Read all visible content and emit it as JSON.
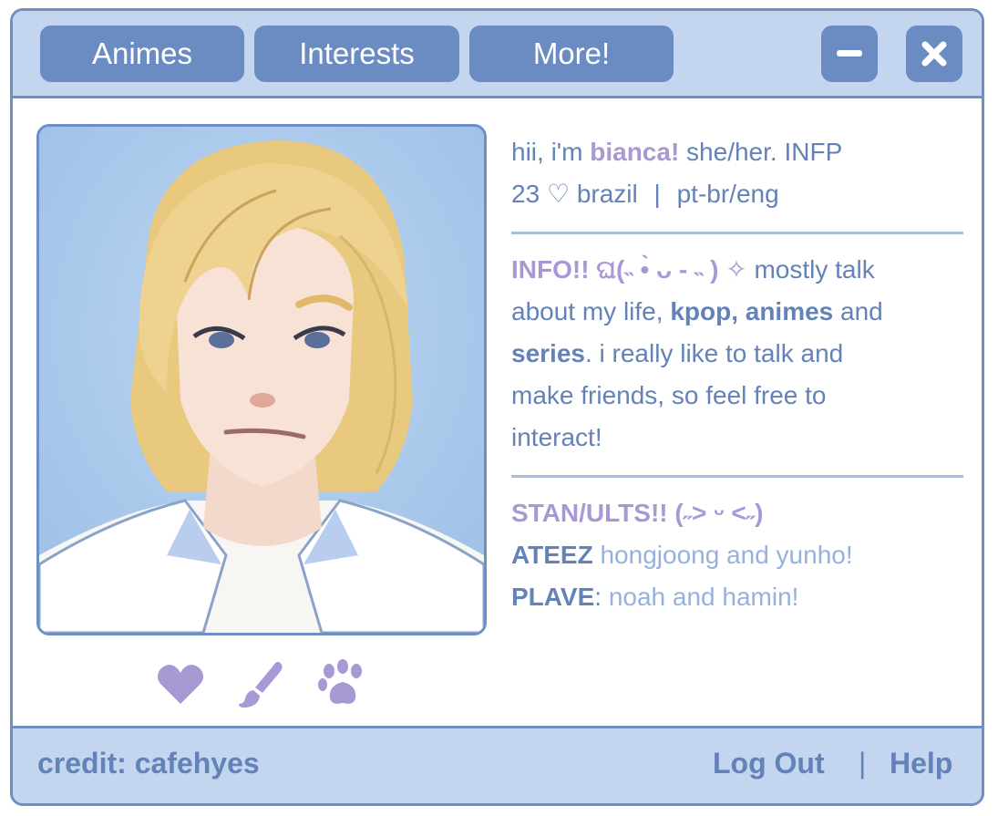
{
  "tabs": {
    "animes": "Animes",
    "interests": "Interests",
    "more": "More!"
  },
  "profile": {
    "intro_prefix": "hii, i'm ",
    "name": "bianca!",
    "intro_suffix": " she/her. INFP",
    "age": "23",
    "heart_glyph": "♡",
    "country": " brazil",
    "separator": "|",
    "languages": "pt-br/eng",
    "info_label": "INFO!! ଘ(˵ •̀ ᴗ - ˵ ) ✧",
    "info_text_1": " mostly talk",
    "info_text_2": "about my life, ",
    "info_bold_1": "kpop, animes",
    "info_text_3": " and",
    "info_bold_2": "series",
    "info_text_4": ". i really like to talk and",
    "info_text_5": "make friends, so feel free to",
    "info_text_6": "interact!",
    "stan_label": "STAN/ULTS!! (˶˃ ᵕ ˂˶)",
    "group1": "ATEEZ",
    "group1_members": " hongjoong and yunho!",
    "group2": "PLAVE",
    "group2_colon": ":",
    "group2_members": " noah and hamin!"
  },
  "icons": [
    "heart-icon",
    "paintbrush-icon",
    "paw-icon"
  ],
  "footer": {
    "credit": "credit: cafehyes",
    "logout": "Log Out",
    "separator": "|",
    "help": "Help"
  },
  "colors": {
    "accent": "#6a8cc2",
    "bar_bg": "#c3d5ef",
    "lavender": "#a898d4",
    "text_blue": "#6382b8"
  }
}
